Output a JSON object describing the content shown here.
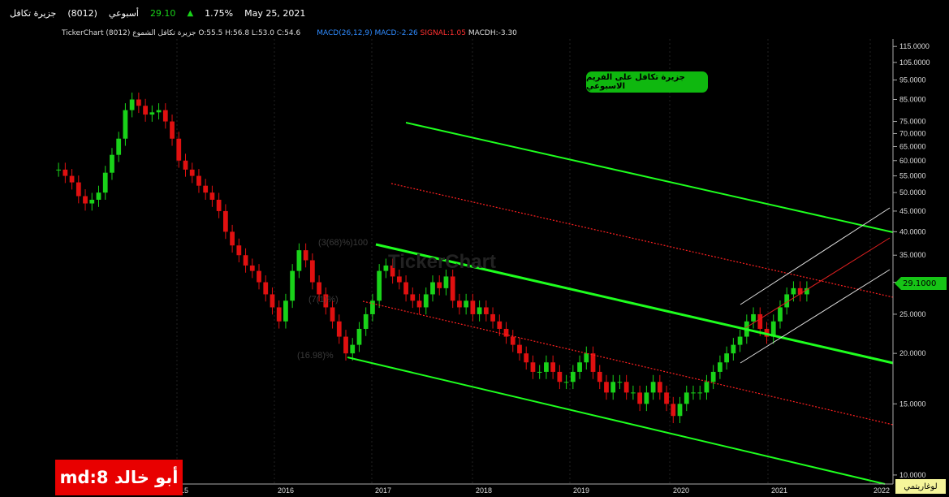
{
  "header": {
    "symbol_name": "جزيرة تكافل",
    "symbol_code": "(8012)",
    "period": "أسبوعي",
    "last_price": "29.10",
    "change_pct": "1.75%",
    "date": "May 25, 2021"
  },
  "legend": {
    "source": "TickerChart جزيرة تكافل الشموع (8012)",
    "ohlc": "O:55.5  H:56.8  L:53.0  C:54.6",
    "macd_name": "MACD(26,12,9)",
    "macd_value": "MACD:-2.26",
    "signal_value": "SIGNAL:1.05",
    "macdh_value": "MACDH:-3.30"
  },
  "annotation_label": "جزيرة تكافل على الفريم الاسبوعي",
  "price_flag": "29.1000",
  "log_scale_label": "لوغاريتمي",
  "author_badge": "md:8 أبو خالد",
  "watermark": "TickerChart",
  "fib_labels": [
    "(3(68)%)100",
    "(7(1)%)",
    "(16.98)%"
  ],
  "colors": {
    "up": "#19d219",
    "down": "#e01010",
    "channel": "#1eff1e",
    "mid_dotted": "#ff2020",
    "accent": "#2f8bff"
  },
  "chart_data": {
    "type": "candlestick",
    "scale": "log",
    "ylim": [
      9.5,
      120
    ],
    "y_ticks": [
      "115.0000",
      "105.0000",
      "95.0000",
      "85.0000",
      "75.0000",
      "70.0000",
      "65.0000",
      "60.0000",
      "55.0000",
      "50.0000",
      "45.0000",
      "40.0000",
      "35.0000",
      "30.0000",
      "25.0000",
      "20.0000",
      "15.0000",
      "10.0000"
    ],
    "x_ticks": [
      "15",
      "2016",
      "2017",
      "2018",
      "2019",
      "2020",
      "2021",
      "2022"
    ],
    "closes": [
      57,
      55,
      53,
      49,
      47,
      48,
      50,
      56,
      62,
      68,
      80,
      85,
      82,
      78,
      79,
      80,
      75,
      68,
      60,
      57,
      55,
      52,
      50,
      48,
      45,
      40,
      37,
      35,
      33,
      32,
      30,
      28,
      26,
      24,
      27,
      32,
      36,
      34,
      30,
      28,
      26,
      24,
      22,
      20,
      21,
      23,
      25,
      27,
      32,
      33,
      31,
      30,
      28,
      27,
      26,
      28,
      30,
      29,
      31,
      27,
      26,
      27,
      25,
      26,
      25,
      24,
      23,
      22,
      21,
      20,
      19,
      18,
      18,
      19,
      18,
      17,
      17,
      18,
      19,
      20,
      18,
      17,
      16,
      17,
      17,
      16,
      16,
      15,
      16,
      17,
      16,
      15,
      14,
      15,
      16,
      16,
      16,
      17,
      18,
      19,
      20,
      21,
      22,
      24,
      25,
      23,
      22,
      24,
      26,
      28,
      29,
      28,
      29
    ],
    "channels": [
      {
        "name": "upper",
        "from": [
          "2017-04",
          74
        ],
        "to": [
          "2022-01",
          39
        ]
      },
      {
        "name": "middle",
        "from": [
          "2017-01",
          37
        ],
        "to": [
          "2022-01",
          18.5
        ]
      },
      {
        "name": "lower",
        "from": [
          "2016-10",
          19
        ],
        "to": [
          "2022-01",
          9.6
        ]
      }
    ]
  }
}
